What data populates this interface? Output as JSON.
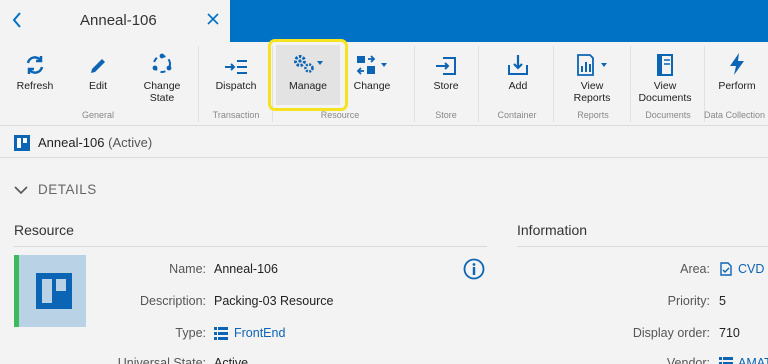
{
  "tab": {
    "title": "Anneal-106"
  },
  "ribbon": {
    "buttons": {
      "refresh": "Refresh",
      "edit": "Edit",
      "change_state_1": "Change",
      "change_state_2": "State",
      "dispatch": "Dispatch",
      "manage": "Manage",
      "change": "Change",
      "store": "Store",
      "add": "Add",
      "view_reports_1": "View",
      "view_reports_2": "Reports",
      "view_documents_1": "View",
      "view_documents_2": "Documents",
      "perform": "Perform"
    },
    "groups": {
      "general": "General",
      "transaction": "Transaction",
      "resource": "Resource",
      "store": "Store",
      "container": "Container",
      "reports": "Reports",
      "documents": "Documents",
      "data_collection": "Data Collection"
    }
  },
  "header": {
    "name": "Anneal-106",
    "status": "(Active)"
  },
  "details": {
    "label": "DETAILS"
  },
  "resource": {
    "title": "Resource",
    "fields": {
      "name_label": "Name:",
      "name_value": "Anneal-106",
      "description_label": "Description:",
      "description_value": "Packing-03 Resource",
      "type_label": "Type:",
      "type_value": "FrontEnd",
      "universal_state_label": "Universal State:",
      "universal_state_value": "Active"
    }
  },
  "information": {
    "title": "Information",
    "fields": {
      "area_label": "Area:",
      "area_value": "CVD",
      "priority_label": "Priority:",
      "priority_value": "5",
      "display_order_label": "Display order:",
      "display_order_value": "710",
      "vendor_label": "Vendor:",
      "vendor_value": "AMAT"
    }
  },
  "colors": {
    "accent_blue": "#0072c6",
    "highlight_yellow": "#f5e321",
    "status_green": "#3dbb5a",
    "link": "#0b64b4"
  }
}
